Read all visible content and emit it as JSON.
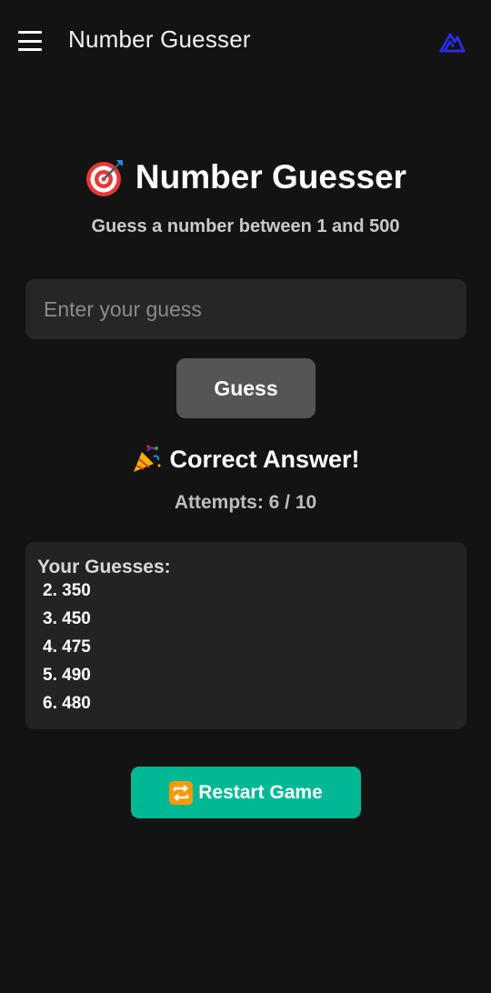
{
  "appbar": {
    "title": "Number Guesser",
    "menu_icon": "hamburger-menu-icon",
    "logo_icon": "app-logo-icon",
    "logo_color": "#2a2ae0"
  },
  "main": {
    "heading_icon": "target-emoji",
    "heading": "Number Guesser",
    "subtitle": "Guess a number between 1 and 500",
    "input_placeholder": "Enter your guess",
    "input_value": "",
    "guess_button": "Guess",
    "result_icon": "party-popper-emoji",
    "result_text": "Correct Answer!",
    "attempts_text": "Attempts: 6 / 10"
  },
  "guesses": {
    "title": "Your Guesses:",
    "items": [
      "2. 350",
      "3. 450",
      "4. 475",
      "5. 490",
      "6. 480"
    ]
  },
  "restart": {
    "icon": "repeat-emoji",
    "label": "Restart Game",
    "color": "#00b894"
  }
}
